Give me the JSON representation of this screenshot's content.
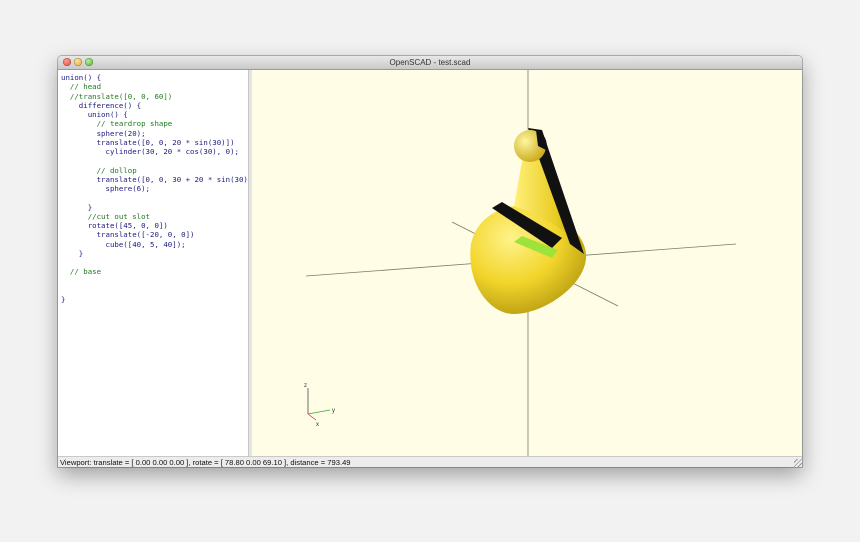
{
  "window": {
    "title": "OpenSCAD - test.scad"
  },
  "editor": {
    "lines": [
      {
        "text": "union() {",
        "kind": "kw"
      },
      {
        "text": "  // head",
        "kind": "cmt"
      },
      {
        "text": "  //translate([0, 0, 60])",
        "kind": "cmt"
      },
      {
        "text": "    difference() {",
        "kind": "kw"
      },
      {
        "text": "      union() {",
        "kind": "kw"
      },
      {
        "text": "        // teardrop shape",
        "kind": "cmt"
      },
      {
        "text": "        sphere(20);",
        "kind": "kw"
      },
      {
        "text": "        translate([0, 0, 20 * sin(30)])",
        "kind": "kw"
      },
      {
        "text": "          cylinder(30, 20 * cos(30), 0);",
        "kind": "kw"
      },
      {
        "text": "",
        "kind": "kw"
      },
      {
        "text": "        // dollop",
        "kind": "cmt"
      },
      {
        "text": "        translate([0, 0, 30 + 20 * sin(30)])",
        "kind": "kw"
      },
      {
        "text": "          sphere(6);",
        "kind": "kw"
      },
      {
        "text": "",
        "kind": "kw"
      },
      {
        "text": "      }",
        "kind": "kw"
      },
      {
        "text": "      //cut out slot",
        "kind": "cmt"
      },
      {
        "text": "      rotate([45, 0, 0])",
        "kind": "kw"
      },
      {
        "text": "        translate([-20, 0, 0])",
        "kind": "kw"
      },
      {
        "text": "          cube([40, 5, 40]);",
        "kind": "kw"
      },
      {
        "text": "    }",
        "kind": "kw"
      },
      {
        "text": "",
        "kind": "kw"
      },
      {
        "text": "  // base",
        "kind": "cmt"
      },
      {
        "text": "",
        "kind": "kw"
      },
      {
        "text": "",
        "kind": "kw"
      },
      {
        "text": "}",
        "kind": "kw"
      }
    ]
  },
  "viewport": {
    "background": "#fffde5",
    "axes_label_z": "z",
    "axes_label_y": "y",
    "axes_label_x": "x",
    "model_color": "#f2d52b",
    "cut_color": "#9fe33a"
  },
  "status": {
    "text": "Viewport: translate = [ 0.00 0.00 0.00 ], rotate = [ 78.80 0.00 69.10 ], distance = 793.49"
  }
}
